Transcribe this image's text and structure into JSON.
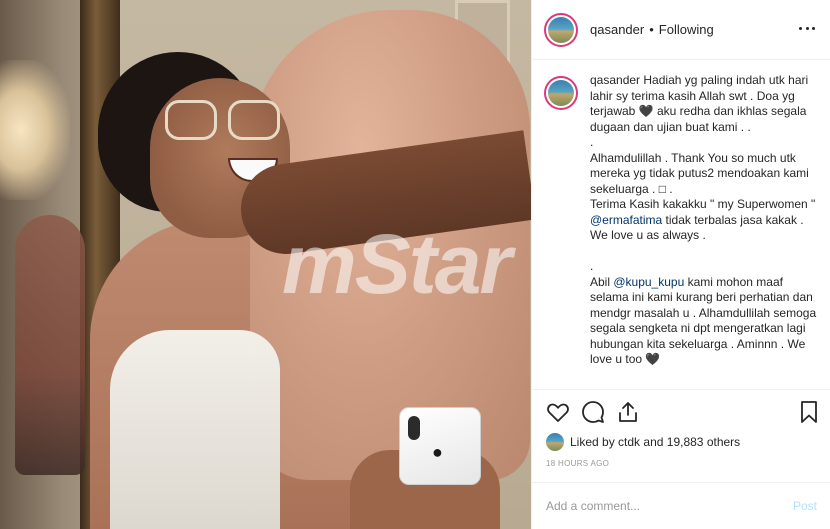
{
  "photo": {
    "watermark": "mStar",
    "phone_logo": ""
  },
  "header": {
    "username": "qasander",
    "separator": "•",
    "follow_status": "Following"
  },
  "caption": {
    "username": "qasander",
    "text1": "Hadiah yg paling indah utk hari lahir sy terima kasih Allah swt . Doa yg terjawab 🖤 aku redha dan ikhlas segala dugaan dan ujian buat kami . .\n.\nAlhamdulillah . Thank You so much utk mereka yg tidak putus2 mendoakan kami sekeluarga . □ .\nTerima Kasih kakakku \" my Superwomen \" ",
    "mention1": "@ermafatima",
    "text2": " tidak terbalas jasa kakak . We love u as always .\n\n.\nAbil ",
    "mention2": "@kupu_kupu",
    "text3": " kami mohon maaf selama ini kami kurang beri perhatian dan mendgr masalah u . Alhamdullilah semoga segala sengketa ni dpt mengeratkan lagi hubungan kita sekeluarga . Aminnn . We love u too 🖤"
  },
  "likes": {
    "prefix": "Liked by",
    "first_liker": "ctdk",
    "middle": "and",
    "others": "19,883 others"
  },
  "timestamp": "18 HOURS AGO",
  "comment_box": {
    "placeholder": "Add a comment...",
    "post_label": "Post"
  },
  "colors": {
    "accent_story_ring": "#d83a7d",
    "post_button_disabled": "#b2dffc",
    "mention": "#003569",
    "secondary_text": "#999999"
  },
  "icons": [
    "heart-icon",
    "comment-icon",
    "share-icon",
    "bookmark-icon",
    "more-options-icon"
  ]
}
